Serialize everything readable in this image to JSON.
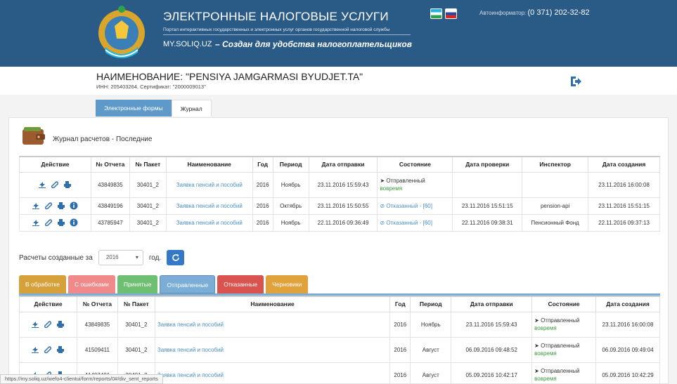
{
  "header": {
    "title": "ЭЛЕКТРОННЫЕ НАЛОГОВЫЕ УСЛУГИ",
    "subtitle": "Портал интерактивных государственных и электронных услуг органов государственной налоговой службы",
    "site": "MY.SOLIQ.UZ",
    "slogan": "– Создан для удобства налогоплательщиков",
    "hotline_label": "Автоинформатор:",
    "hotline_phone": "(0 371) 202-32-82"
  },
  "company": {
    "name": "НАИМЕНОВАНИЕ: \"PENSIYA JAMGARMASI BYUDJET.TA\"",
    "meta": "ИНН: 205403264, Сертификат: \"2000009013\""
  },
  "tabs": [
    "Электронные формы",
    "Журнал"
  ],
  "journal": {
    "title": "Журнал расчетов - Последние",
    "columns": [
      "Действие",
      "№ Отчета",
      "№ Пакет",
      "Наименование",
      "Год",
      "Период",
      "Дата отправки",
      "Состояние",
      "Дата проверки",
      "Инспектор",
      "Дата создания"
    ],
    "rows": [
      {
        "report": "43849835",
        "packet": "30401_2",
        "name": "Заявка пенсий и пособий",
        "year": "2016",
        "period": "Ноябрь",
        "sent": "23.11.2016 15:59:43",
        "state": "Отправленный",
        "state_sub": "вовремя",
        "state_kind": "sent",
        "checked": "",
        "inspector": "",
        "created": "23.11.2016 16:00:08"
      },
      {
        "report": "43849196",
        "packet": "30401_2",
        "name": "Заявка пенсий и пособий",
        "year": "2016",
        "period": "Октябрь",
        "sent": "23.11.2016 15:50:55",
        "state": "Отказанный - [60]",
        "state_sub": "",
        "state_kind": "rej",
        "checked": "23.11.2016 15:51:15",
        "inspector": "pension-api",
        "created": "23.11.2016 15:51:15"
      },
      {
        "report": "43785947",
        "packet": "30401_2",
        "name": "Заявка пенсий и пособий",
        "year": "2016",
        "period": "Ноябрь",
        "sent": "22.11.2016 09:36:49",
        "state": "Отказанный - [60]",
        "state_sub": "",
        "state_kind": "rej",
        "checked": "22.11.2016 09:38:31",
        "inspector": "Пенсионный Фонд",
        "created": "22.11.2016 09:37:13"
      }
    ]
  },
  "period": {
    "label": "Расчеты созданные за",
    "year": "2016",
    "suffix": "год."
  },
  "status_tabs": [
    {
      "label": "В обработке",
      "color": "#d6a13a"
    },
    {
      "label": "С ошибками",
      "color": "#f08a8a"
    },
    {
      "label": "Принятые",
      "color": "#6fbf72"
    },
    {
      "label": "Отправленные",
      "color": "#7aaed6"
    },
    {
      "label": "Отказанные",
      "color": "#d9534f"
    },
    {
      "label": "Черновики",
      "color": "#e0a23a"
    }
  ],
  "list": {
    "columns": [
      "Действие",
      "№ Отчета",
      "№ Пакет",
      "Наименование",
      "Год",
      "Период",
      "Дата отправки",
      "Состояние",
      "Дата создания"
    ],
    "rows": [
      {
        "report": "43849835",
        "packet": "30401_2",
        "name": "Заявка пенсий и пособий",
        "year": "2016",
        "period": "Ноябрь",
        "sent": "23.11.2016 15:59:43",
        "state": "Отправленный",
        "state_sub": "вовремя",
        "created": "23.11.2016 16:00:08"
      },
      {
        "report": "41509411",
        "packet": "30401_2",
        "name": "Заявка пенсий и пособий",
        "year": "2016",
        "period": "Август",
        "sent": "06.09.2016 09:48:52",
        "state": "Отправленный",
        "state_sub": "вовремя",
        "created": "06.09.2016 09:49:04"
      },
      {
        "report": "41497491",
        "packet": "30401_2",
        "name": "Заявка пенсий и пособий",
        "year": "2016",
        "period": "Август",
        "sent": "05.09.2016 10:42:17",
        "state": "Отправленный",
        "state_sub": "вовремя",
        "created": "05.09.2016 10:42:29"
      }
    ]
  },
  "status_url": "https://my.soliq.uz/wefo4-clientui/form/reports/0#/div_sent_reports",
  "colors": {
    "header": "#2a5a86",
    "accent": "#3478c6",
    "link": "#4a90c8"
  }
}
